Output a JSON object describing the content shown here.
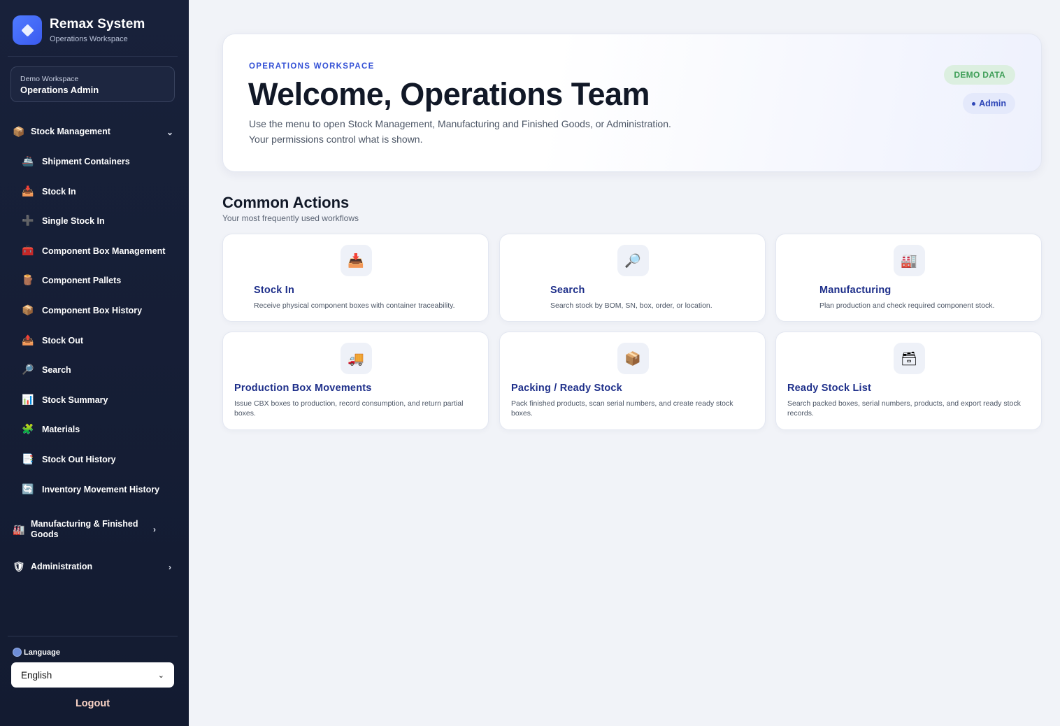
{
  "brand": {
    "title": "Remax System",
    "subtitle": "Operations Workspace"
  },
  "workspace": {
    "label": "Demo Workspace",
    "name": "Operations Admin"
  },
  "nav": {
    "stock_management": {
      "label": "Stock Management",
      "icon": "📦",
      "items": [
        {
          "label": "Shipment Containers",
          "icon": "🚢"
        },
        {
          "label": "Stock In",
          "icon": "📥"
        },
        {
          "label": "Single Stock In",
          "icon": "➕"
        },
        {
          "label": "Component Box Management",
          "icon": "🧰"
        },
        {
          "label": "Component Pallets",
          "icon": "🪵"
        },
        {
          "label": "Component Box History",
          "icon": "📦"
        },
        {
          "label": "Stock Out",
          "icon": "📤"
        },
        {
          "label": "Search",
          "icon": "🔎"
        },
        {
          "label": "Stock Summary",
          "icon": "📊"
        },
        {
          "label": "Materials",
          "icon": "🧩"
        },
        {
          "label": "Stock Out History",
          "icon": "📑"
        },
        {
          "label": "Inventory Movement History",
          "icon": "🔄"
        }
      ]
    },
    "manufacturing": {
      "label": "Manufacturing & Finished Goods",
      "icon": "🏭"
    },
    "administration": {
      "label": "Administration",
      "icon": "🛡"
    }
  },
  "language": {
    "label": "Language",
    "selected": "English"
  },
  "logout": "Logout",
  "hero": {
    "eyebrow": "OPERATIONS WORKSPACE",
    "title": "Welcome, Operations Team",
    "desc_line1": "Use the menu to open Stock Management, Manufacturing and Finished Goods, or Administration.",
    "desc_line2": "Your permissions control what is shown.",
    "badge_demo": "DEMO DATA",
    "badge_admin": "Admin"
  },
  "actions": {
    "title": "Common Actions",
    "subtitle": "Your most frequently used workflows",
    "cards": [
      {
        "title": "Stock In",
        "desc": "Receive physical component boxes with container traceability.",
        "icon": "📥"
      },
      {
        "title": "Search",
        "desc": "Search stock by BOM, SN, box, order, or location.",
        "icon": "🔎"
      },
      {
        "title": "Manufacturing",
        "desc": "Plan production and check required component stock.",
        "icon": "🏭"
      },
      {
        "title": "Production Box Movements",
        "desc": "Issue CBX boxes to production, record consumption, and return partial boxes.",
        "icon": "🚚"
      },
      {
        "title": "Packing / Ready Stock",
        "desc": "Pack finished products, scan serial numbers, and create ready stock boxes.",
        "icon": "📦"
      },
      {
        "title": "Ready Stock List",
        "desc": "Search packed boxes, serial numbers, products, and export ready stock records.",
        "icon": "🗃"
      }
    ]
  }
}
